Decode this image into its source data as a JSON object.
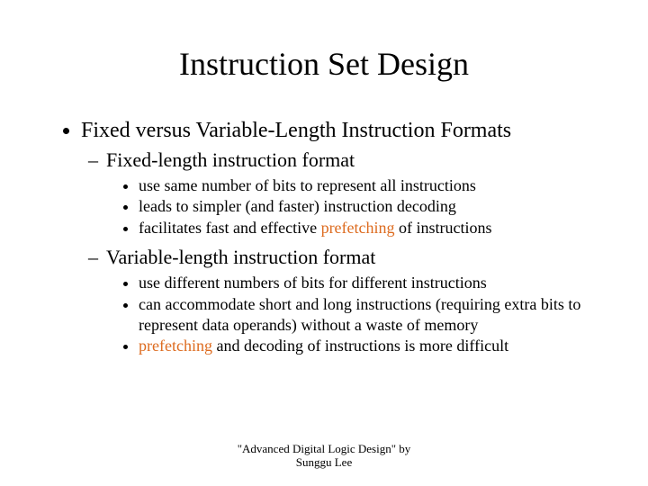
{
  "title": "Instruction Set Design",
  "l1": {
    "heading": "Fixed versus Variable-Length Instruction Formats",
    "sub": [
      {
        "heading": "Fixed-length instruction format",
        "points": [
          {
            "pre": "use same number of bits to represent all instructions",
            "hl": "",
            "post": ""
          },
          {
            "pre": "leads to simpler (and faster) instruction decoding",
            "hl": "",
            "post": ""
          },
          {
            "pre": "facilitates fast and effective ",
            "hl": "prefetching",
            "post": " of instructions"
          }
        ]
      },
      {
        "heading": "Variable-length instruction format",
        "points": [
          {
            "pre": "use different numbers of bits for different instructions",
            "hl": "",
            "post": ""
          },
          {
            "pre": "can accommodate short and long instructions (requiring extra bits to represent data operands) without a waste of memory",
            "hl": "",
            "post": ""
          },
          {
            "pre": "",
            "hl": "prefetching",
            "post": " and decoding of instructions is more difficult"
          }
        ]
      }
    ]
  },
  "footer": {
    "line1": "\"Advanced Digital Logic Design\" by",
    "line2": "Sunggu Lee"
  }
}
